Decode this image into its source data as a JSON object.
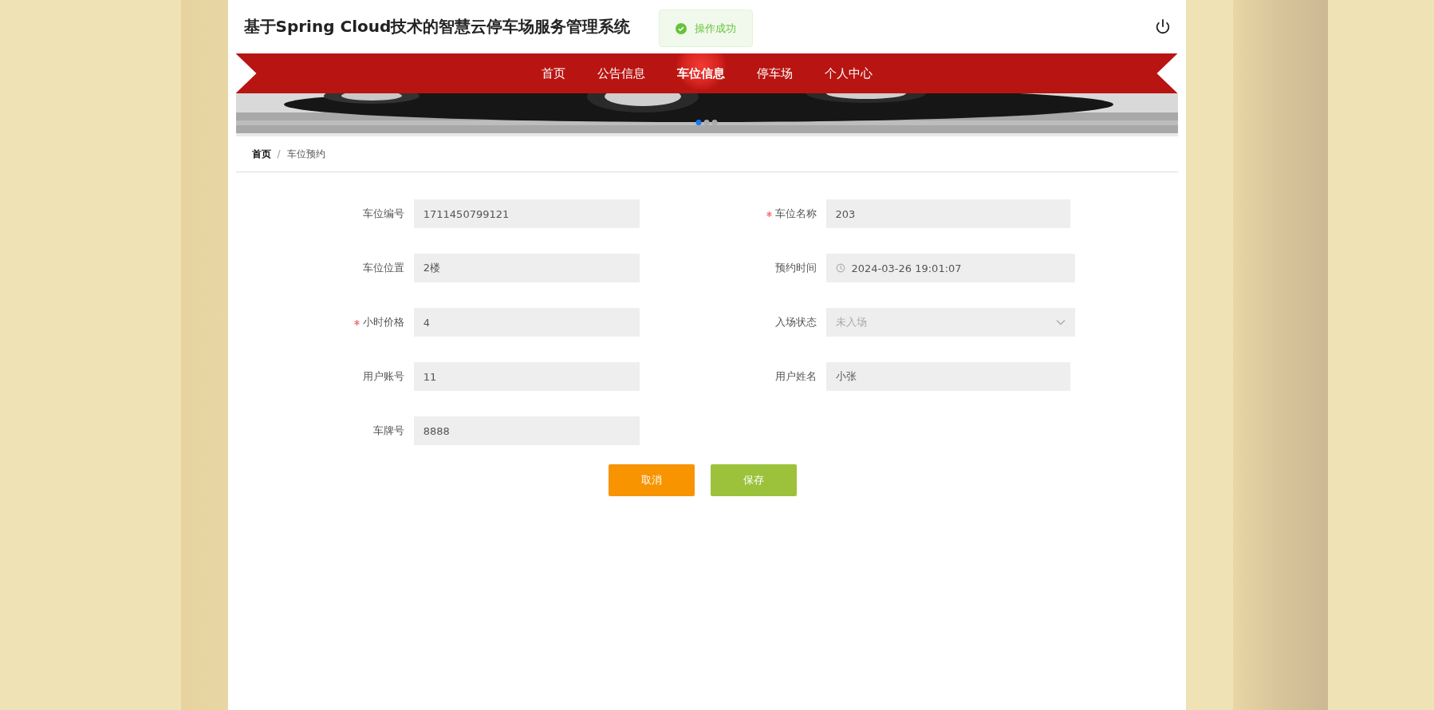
{
  "header": {
    "title": "基于Spring Cloud技术的智慧云停车场服务管理系统"
  },
  "toast": {
    "message": "操作成功"
  },
  "nav": [
    {
      "label": "首页",
      "selected": false
    },
    {
      "label": "公告信息",
      "selected": false
    },
    {
      "label": "车位信息",
      "selected": true
    },
    {
      "label": "停车场",
      "selected": false
    },
    {
      "label": "个人中心",
      "selected": false
    }
  ],
  "carousel": {
    "dots": [
      {
        "selected": true
      },
      {
        "selected": false
      },
      {
        "selected": false
      }
    ]
  },
  "breadcrumb": {
    "separator": "/",
    "items": [
      {
        "label": "首页",
        "current": false
      },
      {
        "label": "车位预约",
        "current": true
      }
    ]
  },
  "form": {
    "fields": [
      {
        "label": "车位编号",
        "value": "1711450799121",
        "required": false,
        "kind": "text"
      },
      {
        "label": "车位名称",
        "value": "203",
        "required": true,
        "kind": "text"
      },
      {
        "label": "车位位置",
        "value": "2楼",
        "required": false,
        "kind": "text"
      },
      {
        "label": "预约时间",
        "value": "2024-03-26 19:01:07",
        "required": false,
        "kind": "date"
      },
      {
        "label": "小时价格",
        "value": "4",
        "required": true,
        "kind": "text"
      },
      {
        "label": "入场状态",
        "value": "未入场",
        "required": false,
        "kind": "select"
      },
      {
        "label": "用户账号",
        "value": "11",
        "required": false,
        "kind": "text"
      },
      {
        "label": "用户姓名",
        "value": "小张",
        "required": false,
        "kind": "text"
      },
      {
        "label": "车牌号",
        "value": "8888",
        "required": false,
        "kind": "text"
      }
    ],
    "buttons": [
      {
        "label": "取消",
        "kind": "cancel"
      },
      {
        "label": "保存",
        "kind": "save"
      }
    ]
  }
}
